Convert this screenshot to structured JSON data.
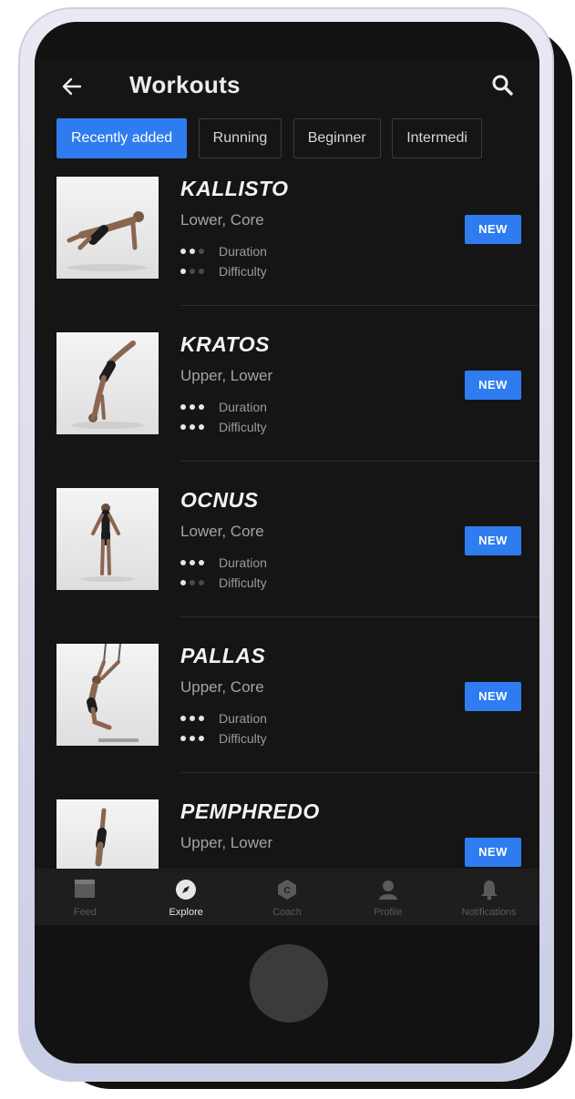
{
  "header": {
    "title": "Workouts",
    "back_icon": "arrow-left-icon",
    "search_icon": "search-icon"
  },
  "filters": [
    {
      "label": "Recently added",
      "active": true
    },
    {
      "label": "Running",
      "active": false
    },
    {
      "label": "Beginner",
      "active": false
    },
    {
      "label": "Intermedi",
      "active": false
    }
  ],
  "workouts": [
    {
      "name": "KALLISTO",
      "tags": "Lower, Core",
      "duration_level": 2,
      "difficulty_level": 1,
      "duration_label": "Duration",
      "difficulty_label": "Difficulty",
      "badge": "NEW"
    },
    {
      "name": "KRATOS",
      "tags": "Upper, Lower",
      "duration_level": 3,
      "difficulty_level": 3,
      "duration_label": "Duration",
      "difficulty_label": "Difficulty",
      "badge": "NEW"
    },
    {
      "name": "OCNUS",
      "tags": "Lower, Core",
      "duration_level": 3,
      "difficulty_level": 1,
      "duration_label": "Duration",
      "difficulty_label": "Difficulty",
      "badge": "NEW"
    },
    {
      "name": "PALLAS",
      "tags": "Upper, Core",
      "duration_level": 3,
      "difficulty_level": 3,
      "duration_label": "Duration",
      "difficulty_label": "Difficulty",
      "badge": "NEW"
    },
    {
      "name": "PEMPHREDO",
      "tags": "Upper, Lower",
      "badge": "NEW"
    }
  ],
  "nav": [
    {
      "label": "Feed",
      "icon": "feed-icon",
      "active": false
    },
    {
      "label": "Explore",
      "icon": "compass-icon",
      "active": true
    },
    {
      "label": "Coach",
      "icon": "coach-icon",
      "active": false
    },
    {
      "label": "Profile",
      "icon": "profile-icon",
      "active": false
    },
    {
      "label": "Notifications",
      "icon": "bell-icon",
      "active": false
    }
  ],
  "colors": {
    "accent": "#2e7cf0",
    "background": "#151515",
    "nav_background": "#1e1e1e"
  }
}
